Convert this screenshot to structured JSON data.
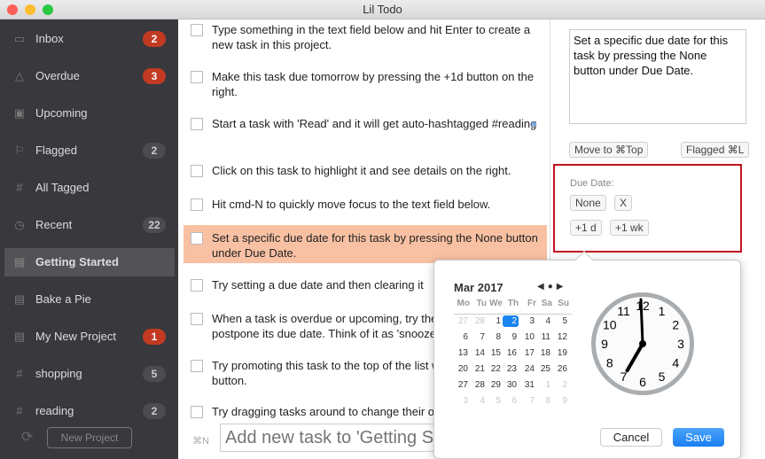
{
  "window": {
    "title": "Lil Todo"
  },
  "colors": {
    "accent": "#1a84f0",
    "badge_red": "#c23a22",
    "selection": "#f9c1a3",
    "due_highlight": "#c0141e"
  },
  "sidebar": {
    "items": [
      {
        "label": "Inbox",
        "icon": "inbox-icon",
        "badge": "2",
        "badge_style": "red"
      },
      {
        "label": "Overdue",
        "icon": "warning-icon",
        "badge": "3",
        "badge_style": "red"
      },
      {
        "label": "Upcoming",
        "icon": "calendar-icon",
        "badge": null
      },
      {
        "label": "Flagged",
        "icon": "flag-icon",
        "badge": "2",
        "badge_style": "grey"
      },
      {
        "label": "All Tagged",
        "icon": "hashtag-icon",
        "badge": null
      },
      {
        "label": "Recent",
        "icon": "clock-icon",
        "badge": "22",
        "badge_style": "grey"
      },
      {
        "label": "Getting Started",
        "icon": "project-icon",
        "badge": null,
        "selected": true
      },
      {
        "label": "Bake a Pie",
        "icon": "project-icon",
        "badge": null
      },
      {
        "label": "My New Project",
        "icon": "project-icon",
        "badge": "1",
        "badge_style": "red"
      },
      {
        "label": "shopping",
        "icon": "hashtag-icon",
        "badge": "5",
        "badge_style": "grey"
      },
      {
        "label": "reading",
        "icon": "hashtag-icon",
        "badge": "2",
        "badge_style": "grey"
      }
    ],
    "new_project": "New Project"
  },
  "tasks": [
    {
      "text": "Type something in the text field below and hit Enter to create a new task in this project."
    },
    {
      "text": "Make this task due tomorrow by pressing the +1d button on the right."
    },
    {
      "text": "Start a task with 'Read' and it will get auto-hashtagged #reading",
      "flagged": true
    },
    {
      "text": "Click on this task to highlight it and see details on the right."
    },
    {
      "text": "Hit cmd-N to quickly move focus to the text field below."
    },
    {
      "text": "Set a specific due date for this task by pressing the None button under Due Date.",
      "selected": true
    },
    {
      "text": "Try setting a due date and then clearing it"
    },
    {
      "text": "When a task is overdue or upcoming, try the +1d button to postpone its due date. Think of it as 'snooze'."
    },
    {
      "text": "Try promoting this task to the top of the list with the Move to Top button."
    },
    {
      "text": "Try dragging tasks around to change their order."
    }
  ],
  "add_task": {
    "shortcut": "⌘N",
    "placeholder": "Add new task to 'Getting Started'"
  },
  "detail": {
    "notes": "Set a specific due date for this task by pressing the None button under Due Date.",
    "move_top": "Move to ⌘Top",
    "flagged": "Flagged ⌘L",
    "due_label": "Due Date:",
    "none": "None",
    "clear": "X",
    "plus_day": "+1 d",
    "plus_week": "+1 wk"
  },
  "picker": {
    "month": "Mar 2017",
    "weekdays": [
      "Mo",
      "Tu",
      "We",
      "Th",
      "Fr",
      "Sa",
      "Su"
    ],
    "weeks": [
      [
        "27",
        "28",
        "1",
        "2",
        "3",
        "4",
        "5"
      ],
      [
        "6",
        "7",
        "8",
        "9",
        "10",
        "11",
        "12"
      ],
      [
        "13",
        "14",
        "15",
        "16",
        "17",
        "18",
        "19"
      ],
      [
        "20",
        "21",
        "22",
        "23",
        "24",
        "25",
        "26"
      ],
      [
        "27",
        "28",
        "29",
        "30",
        "31",
        "1",
        "2"
      ],
      [
        "3",
        "4",
        "5",
        "6",
        "7",
        "8",
        "9"
      ]
    ],
    "selected_day": "2",
    "time": "7:00",
    "clock_numbers": [
      "12",
      "1",
      "2",
      "3",
      "4",
      "5",
      "6",
      "7",
      "8",
      "9",
      "10",
      "11"
    ],
    "cancel": "Cancel",
    "save": "Save"
  }
}
